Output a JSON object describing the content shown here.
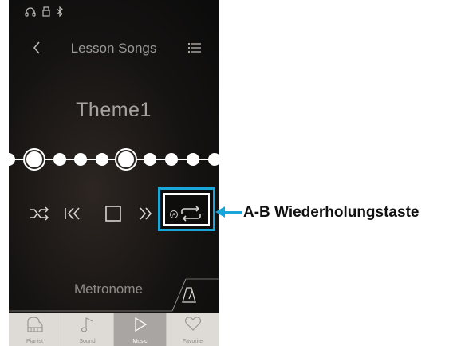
{
  "header": {
    "title": "Lesson Songs",
    "icons": [
      "headphones-icon",
      "usb-icon",
      "bluetooth-icon"
    ]
  },
  "song": {
    "title": "Theme1"
  },
  "progress": {
    "dot_count": 11,
    "large_dots": [
      1,
      6
    ]
  },
  "controls": [
    "shuffle-icon",
    "previous-icon",
    "stop-icon",
    "next-icon",
    "ab-repeat-icon"
  ],
  "metronome": {
    "label": "Metronome"
  },
  "bottom_nav": {
    "items": [
      {
        "label": "Pianist",
        "active": false
      },
      {
        "label": "Sound",
        "active": false
      },
      {
        "label": "Music",
        "active": true
      },
      {
        "label": "Favorite",
        "active": false
      }
    ]
  },
  "callout": {
    "label": "A-B Wiederholungstaste"
  },
  "colors": {
    "highlight": "#19a6d8"
  }
}
